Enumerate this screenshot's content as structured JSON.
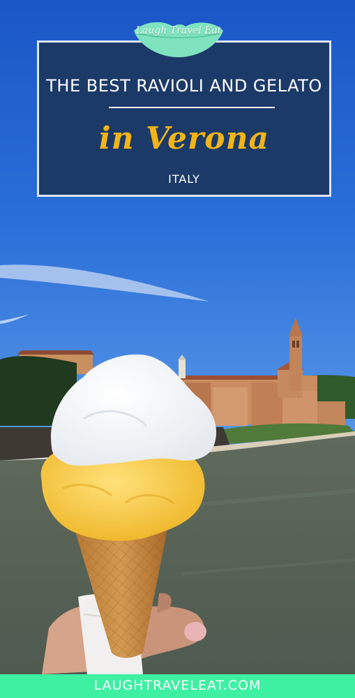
{
  "logo": {
    "text": "Laugh Travel Eat"
  },
  "title_card": {
    "headline": "THE BEST RAVIOLI AND GELATO",
    "script": "in Verona",
    "country": "ITALY"
  },
  "footer": {
    "url": "LAUGHTRAVELEAT.COM"
  },
  "colors": {
    "sky": "#1f5fce",
    "card": "#1c3a68",
    "script_gold": "#f2b418",
    "footer_band": "#3ef0a2",
    "logo_green": "#7fe3c0"
  }
}
